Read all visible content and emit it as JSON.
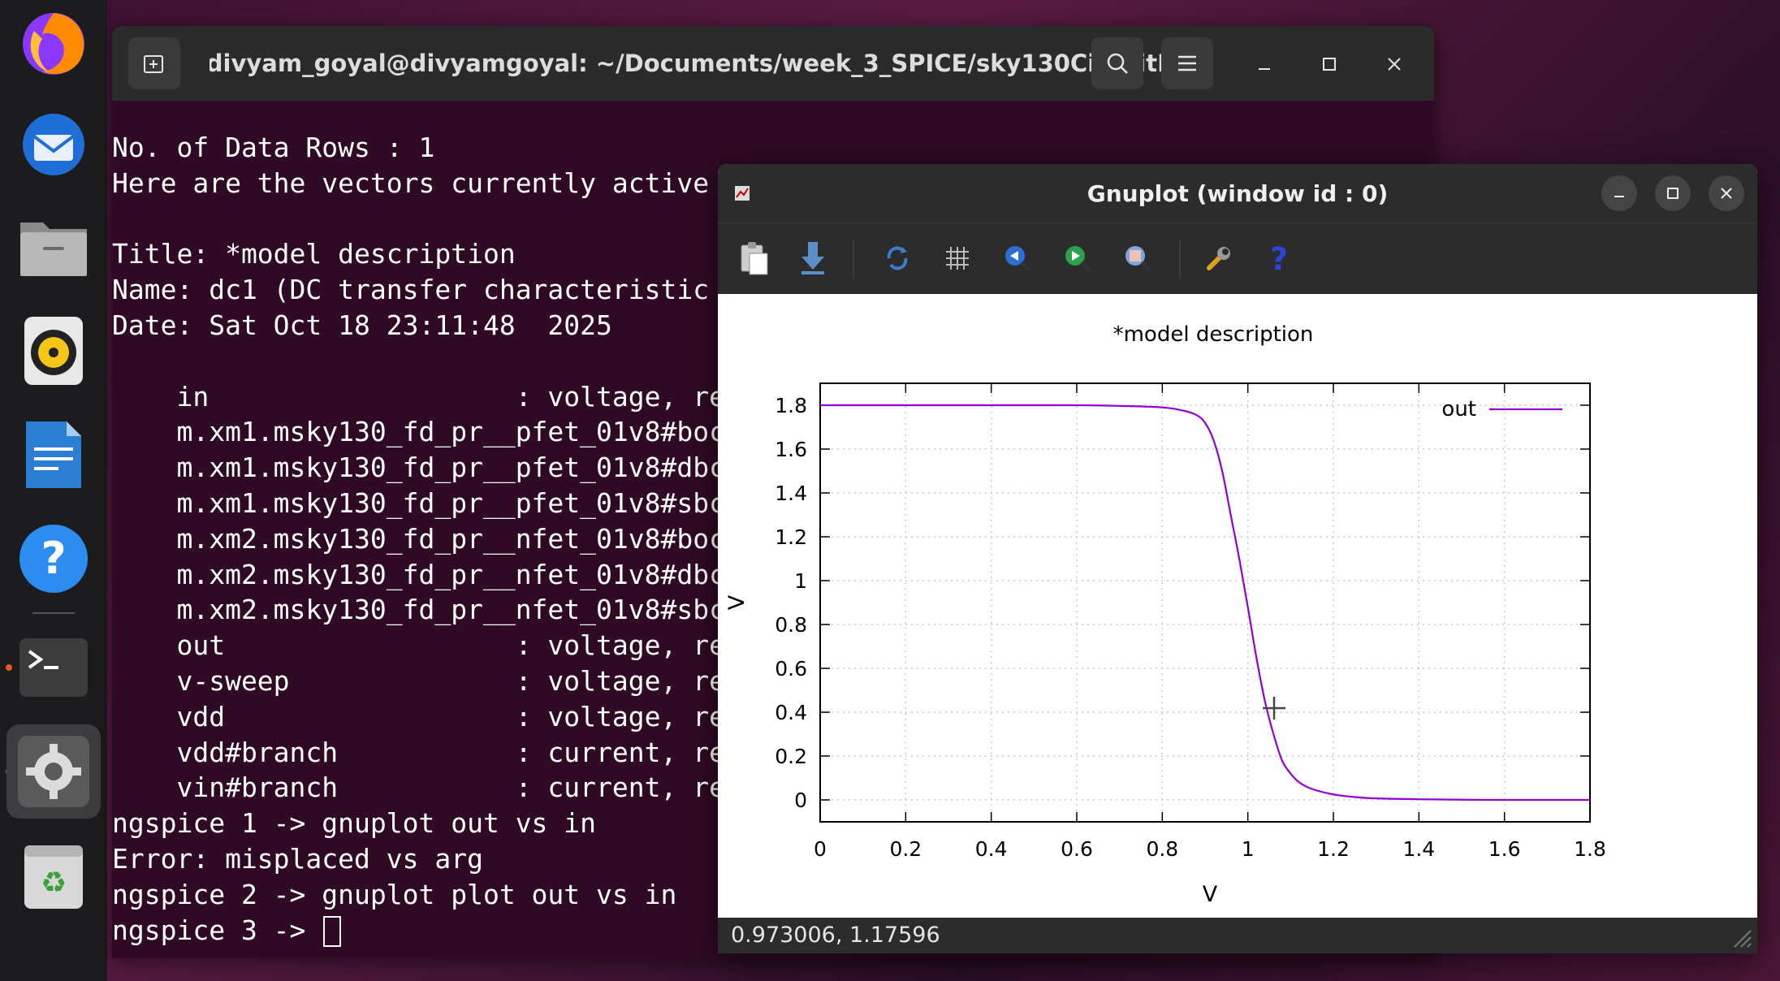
{
  "dock": {
    "apps": [
      "firefox-icon",
      "thunderbird-icon",
      "files-icon",
      "rhythmbox-icon",
      "writer-icon",
      "help-icon",
      "terminal-icon",
      "settings-icon",
      "trash-icon"
    ]
  },
  "terminal": {
    "title": "divyam_goyal@divyamgoyal: ~/Documents/week_3_SPICE/sky130CircuitD...",
    "lines": [
      "No. of Data Rows : 1",
      "Here are the vectors currently active",
      "",
      "Title: *model description",
      "Name: dc1 (DC transfer characteristic",
      "Date: Sat Oct 18 23:11:48  2025",
      "",
      "    in                   : voltage, re",
      "    m.xm1.msky130_fd_pr__pfet_01v8#boc",
      "    m.xm1.msky130_fd_pr__pfet_01v8#dbc",
      "    m.xm1.msky130_fd_pr__pfet_01v8#sbc",
      "    m.xm2.msky130_fd_pr__nfet_01v8#boc",
      "    m.xm2.msky130_fd_pr__nfet_01v8#dbc",
      "    m.xm2.msky130_fd_pr__nfet_01v8#sbc",
      "    out                  : voltage, re",
      "    v-sweep              : voltage, re",
      "    vdd                  : voltage, re",
      "    vdd#branch           : current, re",
      "    vin#branch           : current, re",
      "ngspice 1 -> gnuplot out vs in",
      "Error: misplaced vs arg",
      "ngspice 2 -> gnuplot plot out vs in"
    ],
    "prompt": "ngspice 3 -> "
  },
  "gnuplot": {
    "title": "Gnuplot (window id : 0)",
    "status": "0.973006,  1.17596",
    "toolbar": [
      "copy-icon",
      "export-icon",
      "replot-icon",
      "grid-icon",
      "zoom-back-icon",
      "zoom-forward-icon",
      "autoscale-icon",
      "settings-icon",
      "help-icon"
    ]
  },
  "chart_data": {
    "type": "line",
    "title": "*model description",
    "xlabel": "V",
    "ylabel": "V",
    "xlim": [
      0,
      1.8
    ],
    "ylim": [
      -0.1,
      1.9
    ],
    "xticks": [
      "0",
      "0.2",
      "0.4",
      "0.6",
      "0.8",
      "1",
      "1.2",
      "1.4",
      "1.6",
      "1.8"
    ],
    "yticks": [
      "0",
      "0.2",
      "0.4",
      "0.6",
      "0.8",
      "1",
      "1.2",
      "1.4",
      "1.6",
      "1.8"
    ],
    "grid": true,
    "legend_position": "top-right",
    "series": [
      {
        "name": "out",
        "color": "#9400d3",
        "x": [
          0,
          0.2,
          0.4,
          0.6,
          0.7,
          0.8,
          0.85,
          0.88,
          0.9,
          0.92,
          0.94,
          0.96,
          0.98,
          1.0,
          1.02,
          1.04,
          1.06,
          1.08,
          1.1,
          1.12,
          1.15,
          1.2,
          1.25,
          1.3,
          1.4,
          1.5,
          1.6,
          1.8
        ],
        "y": [
          1.8,
          1.8,
          1.8,
          1.8,
          1.797,
          1.79,
          1.775,
          1.755,
          1.72,
          1.64,
          1.5,
          1.3,
          1.1,
          0.88,
          0.65,
          0.45,
          0.3,
          0.18,
          0.12,
          0.08,
          0.05,
          0.025,
          0.013,
          0.007,
          0.003,
          0.001,
          0.0,
          0.0
        ]
      }
    ]
  }
}
